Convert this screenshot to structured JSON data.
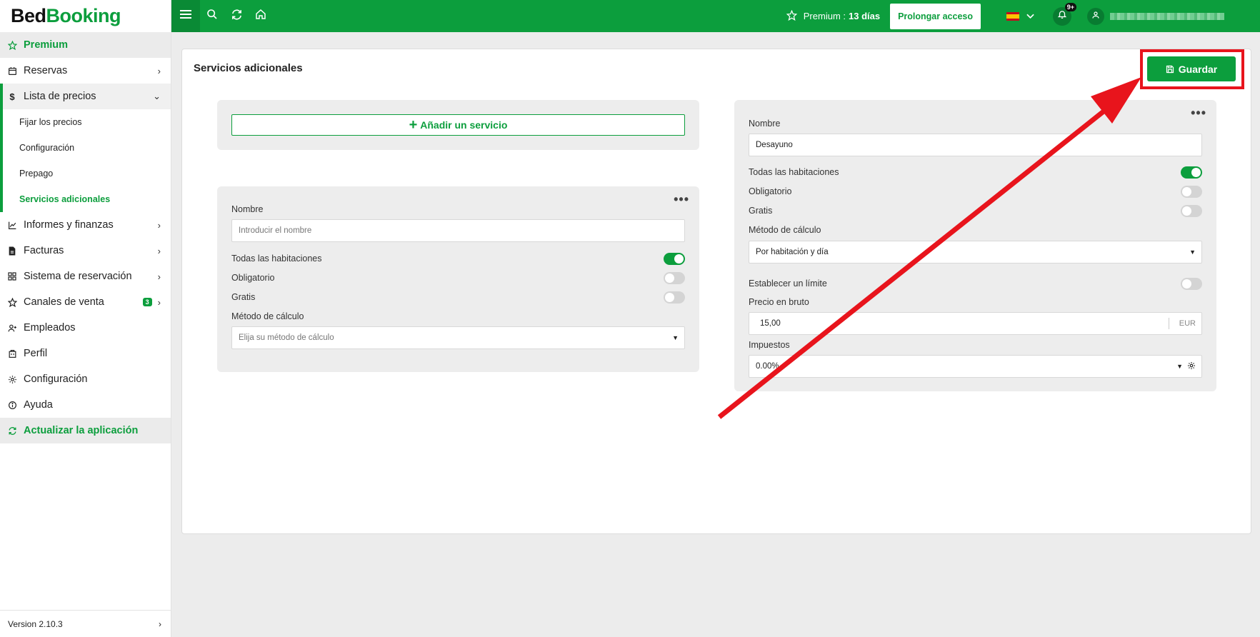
{
  "app": {
    "logo_part1": "Bed",
    "logo_part2": "Booking"
  },
  "sidebar": {
    "premium": "Premium",
    "items": [
      {
        "label": "Reservas",
        "icon": "calendar-icon"
      },
      {
        "label": "Lista de precios",
        "icon": "dollar-icon"
      },
      {
        "label": "Informes y finanzas",
        "icon": "chart-icon"
      },
      {
        "label": "Facturas",
        "icon": "invoice-icon"
      },
      {
        "label": "Sistema de reservación",
        "icon": "grid-icon"
      },
      {
        "label": "Canales de venta",
        "icon": "star-icon",
        "badge": "3"
      },
      {
        "label": "Empleados",
        "icon": "user-add-icon"
      },
      {
        "label": "Perfil",
        "icon": "building-icon"
      },
      {
        "label": "Configuración",
        "icon": "gear-icon"
      },
      {
        "label": "Ayuda",
        "icon": "info-icon"
      }
    ],
    "sub_items": [
      "Fijar los precios",
      "Configuración",
      "Prepago",
      "Servicios adicionales"
    ],
    "update": "Actualizar la aplicación",
    "version": "Version 2.10.3"
  },
  "topbar": {
    "premium_label": "Premium :",
    "premium_days": "13 días",
    "extend_button": "Prolongar acceso",
    "notifications_badge": "9+"
  },
  "panel": {
    "title": "Servicios adicionales",
    "save_button": "Guardar",
    "add_service": "Añadir un servicio",
    "new_service": {
      "name_label": "Nombre",
      "name_placeholder": "Introducir el nombre",
      "all_rooms_label": "Todas las habitaciones",
      "all_rooms_on": true,
      "mandatory_label": "Obligatorio",
      "mandatory_on": false,
      "free_label": "Gratis",
      "free_on": false,
      "method_label": "Método de cálculo",
      "method_placeholder": "Elija su método de cálculo"
    },
    "breakfast_service": {
      "name_label": "Nombre",
      "name_value": "Desayuno",
      "all_rooms_label": "Todas las habitaciones",
      "all_rooms_on": true,
      "mandatory_label": "Obligatorio",
      "mandatory_on": false,
      "free_label": "Gratis",
      "free_on": false,
      "method_label": "Método de cálculo",
      "method_value": "Por habitación y día",
      "limit_label": "Establecer un límite",
      "limit_on": false,
      "price_label": "Precio en bruto",
      "price_value": "15,00",
      "currency": "EUR",
      "taxes_label": "Impuestos",
      "taxes_value": "0.00%"
    }
  },
  "colors": {
    "brand": "#0c9e3d",
    "highlight": "#e8141c"
  }
}
